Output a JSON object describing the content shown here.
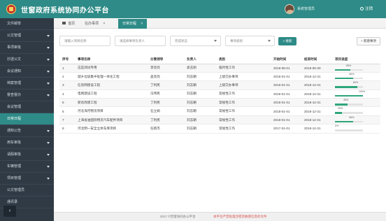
{
  "header": {
    "title": "世窗政府系统协同办公平台",
    "user_name": "系统管理员",
    "logout_label": "注销"
  },
  "sidebar": {
    "items": [
      {
        "label": "文件邮草",
        "caret": false,
        "active": false
      },
      {
        "label": "公文管理",
        "caret": true,
        "active": false
      },
      {
        "label": "事项审批",
        "caret": true,
        "active": false
      },
      {
        "label": "抄送公文",
        "caret": true,
        "active": false
      },
      {
        "label": "会议通知",
        "caret": true,
        "active": false
      },
      {
        "label": "档案管理",
        "caret": true,
        "active": false
      },
      {
        "label": "督查督办",
        "caret": true,
        "active": false
      },
      {
        "label": "会议管理",
        "caret": false,
        "active": false
      },
      {
        "label": "日常日程",
        "caret": false,
        "active": true
      },
      {
        "label": "通知公告",
        "caret": true,
        "active": false
      },
      {
        "label": "用车审批",
        "caret": true,
        "active": false
      },
      {
        "label": "请假审批",
        "caret": true,
        "active": false
      },
      {
        "label": "车辆管理",
        "caret": true,
        "active": false
      },
      {
        "label": "项目管理",
        "caret": true,
        "active": false
      },
      {
        "label": "公文管理员",
        "caret": false,
        "active": false
      },
      {
        "label": "通讯录",
        "caret": false,
        "active": false
      }
    ],
    "collapse_label": "‹"
  },
  "tabs": [
    {
      "label": "首页",
      "closable": false,
      "active": false
    },
    {
      "label": "在办事项",
      "closable": true,
      "active": false
    },
    {
      "label": "日常日程",
      "closable": true,
      "active": true
    }
  ],
  "filters": {
    "project_name_placeholder": "请输入项目名称",
    "owner_placeholder": "请选择事项负责人",
    "status_placeholder": "完成状态",
    "category_placeholder": "事项类别",
    "search_label": "搜索",
    "add_label": "+ 新建事项"
  },
  "table": {
    "headers": [
      "序号",
      "事项名称",
      "分管领导",
      "负责人",
      "类别",
      "开始时间",
      "结束时间",
      "项目进度"
    ],
    "rows": [
      {
        "no": "1",
        "name": "这是测试专用",
        "leader": "李亮亮",
        "owner": "袁志刚",
        "category": "临时性工作",
        "start": "2018-06-01",
        "end": "2018-06-30",
        "progress_label": "55%",
        "progress": 55
      },
      {
        "no": "2",
        "name": "城乡垃圾集中处理一体化工程",
        "leader": "盖亮亮",
        "owner": "刘志朝",
        "category": "上级交办事项",
        "start": "2018-01-01",
        "end": "2018-12-31",
        "progress_label": "66%",
        "progress": 66
      },
      {
        "no": "3",
        "name": "信息网建设工程",
        "leader": "丁利民",
        "owner": "刘志朝",
        "category": "上级交办事项",
        "start": "2018-01-01",
        "end": "2018-12-31",
        "progress_label": "80%",
        "progress": 80
      },
      {
        "no": "4",
        "name": "电网建设工程",
        "leader": "冯伟民",
        "owner": "刘志朝",
        "category": "常规性工作",
        "start": "2018-01-01",
        "end": "2018-12-31",
        "progress_label": "100%",
        "progress": 100
      },
      {
        "no": "5",
        "name": "新房改建工程",
        "leader": "丁利民",
        "owner": "刘志朝",
        "category": "常规性工作",
        "start": "2018-01-01",
        "end": "2018-12-31",
        "progress_label": "45%",
        "progress": 45
      },
      {
        "no": "6",
        "name": "河北海河物流项目",
        "leader": "石立娟",
        "owner": "刘志朝",
        "category": "常规性工作",
        "start": "2018-01-01",
        "end": "2018-12-31",
        "progress_label": "25%",
        "progress": 25
      },
      {
        "no": "7",
        "name": "上海省油国际物流汽车配件项目",
        "leader": "丁利民",
        "owner": "刘志朝",
        "category": "常规性工作",
        "start": "2018-01-01",
        "end": "2018-12-31",
        "progress_label": "66%",
        "progress": 66
      },
      {
        "no": "8",
        "name": "河北明一安全立体车库项目",
        "leader": "任晓杰",
        "owner": "刘志朝",
        "category": "常规性工作",
        "start": "2017-01-01",
        "end": "2018-12-31",
        "progress_label": "0%",
        "progress": 0
      }
    ]
  },
  "footer": {
    "copyright": "2017 ©世窗协同办公平台",
    "notice": "本平台严禁处理涉密及敏感信息的文件"
  },
  "colors": {
    "accent": "#2e8b87",
    "progress": "#2ea67a",
    "sidebar_bg": "#2f3a45"
  }
}
